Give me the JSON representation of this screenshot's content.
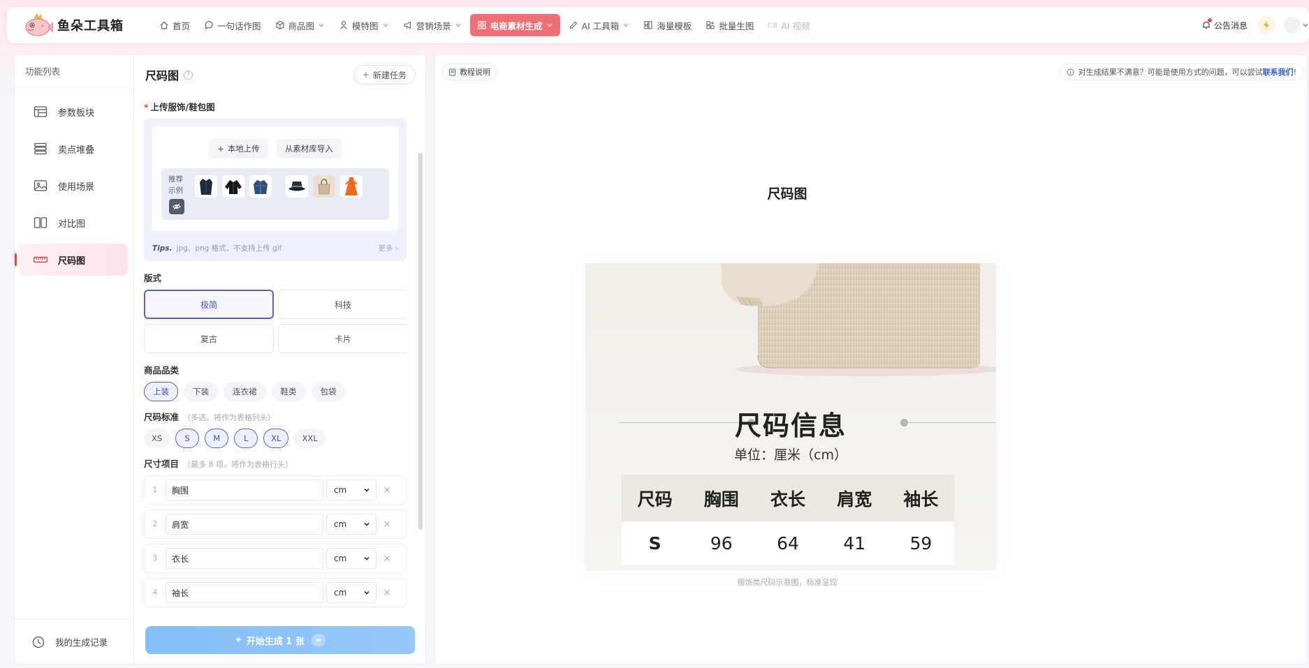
{
  "brand": {
    "name": "鱼朵工具箱"
  },
  "nav": [
    {
      "label": "首页",
      "icon": "home-icon",
      "dropdown": false
    },
    {
      "label": "一句话作图",
      "icon": "chat-bubble-icon",
      "dropdown": false
    },
    {
      "label": "商品图",
      "icon": "cube-icon",
      "dropdown": true
    },
    {
      "label": "模特图",
      "icon": "person-icon",
      "dropdown": true
    },
    {
      "label": "营销场景",
      "icon": "megaphone-icon",
      "dropdown": true
    },
    {
      "label": "电商素材生成",
      "icon": "grid-icon",
      "dropdown": true,
      "active": true
    },
    {
      "label": "AI 工具箱",
      "icon": "pen-icon",
      "dropdown": true
    },
    {
      "label": "海量模板",
      "icon": "template-icon",
      "dropdown": false
    },
    {
      "label": "批量生图",
      "icon": "batch-icon",
      "dropdown": false
    },
    {
      "label": "AI 视频",
      "icon": "video-icon",
      "dropdown": false,
      "disabled": true
    }
  ],
  "topRight": {
    "notice": "公告消息"
  },
  "sidebar": {
    "title": "功能列表",
    "items": [
      {
        "label": "参数板块",
        "icon": "table-icon"
      },
      {
        "label": "卖点堆叠",
        "icon": "stack-icon"
      },
      {
        "label": "使用场景",
        "icon": "image-icon"
      },
      {
        "label": "对比图",
        "icon": "compare-icon"
      },
      {
        "label": "尺码图",
        "icon": "ruler-icon",
        "active": true
      }
    ],
    "history": "我的生成记录"
  },
  "panel": {
    "title": "尺码图",
    "newTask": "新建任务",
    "upload": {
      "label": "上传服饰/鞋包图",
      "localUpload": "本地上传",
      "fromLibrary": "从素材库导入",
      "examplesLabel": "推荐示例",
      "tipsPrefix": "Tips.",
      "tips": "jpg、png 格式，不支持上传 gif",
      "more": "更多 ›"
    },
    "style": {
      "label": "版式",
      "options": [
        "极简",
        "科技",
        "复古",
        "卡片"
      ],
      "selected": "极简"
    },
    "category": {
      "label": "商品品类",
      "options": [
        "上装",
        "下装",
        "连衣裙",
        "鞋类",
        "包袋"
      ],
      "selected": "上装"
    },
    "sizes": {
      "label": "尺码标准",
      "hint": "（多选，将作为表格列头）",
      "options": [
        "XS",
        "S",
        "M",
        "L",
        "XL",
        "XXL"
      ],
      "selected": [
        "S",
        "M",
        "L",
        "XL"
      ]
    },
    "dimensions": {
      "label": "尺寸项目",
      "hint": "（最多 8 项，将作为表格行头）",
      "rows": [
        {
          "index": "1",
          "name": "胸围",
          "unit": "cm"
        },
        {
          "index": "2",
          "name": "肩宽",
          "unit": "cm"
        },
        {
          "index": "3",
          "name": "衣长",
          "unit": "cm"
        },
        {
          "index": "4",
          "name": "袖长",
          "unit": "cm"
        }
      ]
    },
    "generate": {
      "label": "开始生成 1 张",
      "badge": "∞"
    }
  },
  "preview": {
    "tutorial": "教程说明",
    "feedback": "对生成结果不满意？可能是使用方式的问题，可以尝试",
    "feedbackLink": "联系我们",
    "feedbackEnd": "!",
    "title": "尺码图",
    "card": {
      "title": "尺码信息",
      "unit": "单位：厘米（cm）",
      "headers": [
        "尺码",
        "胸围",
        "衣长",
        "肩宽",
        "袖长"
      ],
      "rows": [
        [
          "S",
          "96",
          "64",
          "41",
          "59"
        ]
      ]
    },
    "caption": "服饰类尺码示意图，标准呈现"
  },
  "colors": {
    "accent": "#ef6f76",
    "selectedBorder": "#5466c8",
    "generateButton": "#8cc3f8",
    "link": "#2b5fd9"
  }
}
